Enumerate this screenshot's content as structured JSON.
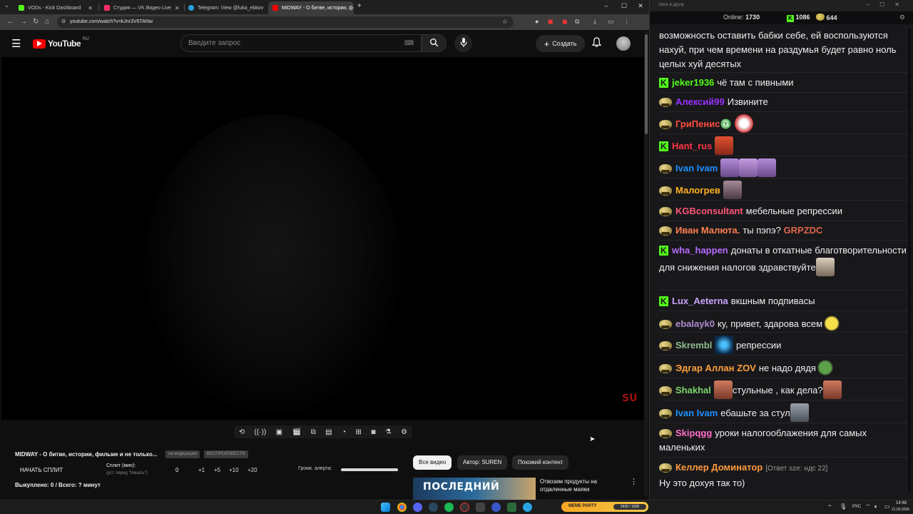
{
  "browser": {
    "tabs": [
      {
        "title": "VODs - Kick Dashboard",
        "color": "#53fc18",
        "active": false
      },
      {
        "title": "Студия — VK Видео Live",
        "color": "#ff2e63",
        "active": false
      },
      {
        "title": "Telegram: View @luka_ebkov",
        "color": "#2aa3e0",
        "active": false
      },
      {
        "title": "MIDWAY - О битве, истории, ф",
        "color": "#ff0000",
        "active": true
      }
    ],
    "new_tab_icon": "plus-icon",
    "url": "youtube.com/watch?v=kJnr3V6TANw"
  },
  "youtube": {
    "logo_text": "YouTube",
    "region": "RU",
    "search_placeholder": "Введите запрос",
    "create_label": "Создать",
    "watermark": "SU",
    "video_title": "MIDWAY - О битве, истории, фильме и не только...",
    "tag1": "на модерацию",
    "tag2": "ВОСПРОИЗВЕСТИ",
    "start_split": "НАЧАТЬ СПЛИТ",
    "split_label": "Сплит (мин):",
    "split_hint": "(уст. перед \"Начать\")",
    "split_value": "0",
    "steps": [
      "+1",
      "+5",
      "+10",
      "+20"
    ],
    "alert_volume_label": "Громк. алерта:",
    "alert_volume_level": 1.0,
    "bought_summary": "Выкуплено: 0 / Всего: ? минут",
    "chips": [
      "Все видео",
      "Автор: SUREN",
      "Похожий контент"
    ],
    "recommendation": {
      "thumbnail_text": "ПОСЛЕДНИЙ",
      "title": "Отвозим продукты на отдаленные маяки"
    }
  },
  "chat": {
    "window_title": "Окно в друзу",
    "online_label": "Online:",
    "online_count": "1730",
    "kick_count": "1086",
    "other_count": "644",
    "messages": [
      {
        "badge": "none",
        "user": "",
        "color": "#efeff1",
        "text": "возможность оставить бабки себе, ей воспользуются нахуй, при чем времени на раздумья будет равно ноль целых хуй десятых",
        "emotes": 0
      },
      {
        "badge": "kick",
        "user": "jeker1936",
        "color": "#53fc18",
        "text": "чё там с пивными",
        "emotes": 0
      },
      {
        "badge": "face",
        "user": "Алексий99",
        "color": "#9b30ff",
        "text": "Извините",
        "emotes": 0
      },
      {
        "badge": "face",
        "user": "ГриПенис♎",
        "color": "#ff4d3d",
        "text": "",
        "emotes": 1
      },
      {
        "badge": "kick",
        "user": "Hant_rus",
        "color": "#ff3344",
        "text": "",
        "emotes": 1
      },
      {
        "badge": "face",
        "user": "Ivan Ivam",
        "color": "#1e90ff",
        "text": "",
        "emotes": 3
      },
      {
        "badge": "face",
        "user": "Малогрев",
        "color": "#ffb020",
        "text": "",
        "emotes": 1
      },
      {
        "badge": "face",
        "user": "KGBconsultant",
        "color": "#ff5577",
        "text": "мебельные репрессии",
        "emotes": 0
      },
      {
        "badge": "face",
        "user": "Иван Малюта.",
        "color": "#ff7f50",
        "text": "ты пэпэ?",
        "ref": "GRPZDC",
        "emotes": 0
      },
      {
        "badge": "kick",
        "user": "wha_happen",
        "color": "#b86bff",
        "text": "донаты в откатные благотворительности для снижения налогов здравствуйте",
        "emotes": 1
      },
      {
        "badge": "kick",
        "user": "Lux_Aeterna",
        "color": "#c8a2ff",
        "text": "вкшным подпивасы",
        "emotes": 0
      },
      {
        "badge": "face",
        "user": "ebalayk0",
        "color": "#b08ad0",
        "text": "ку, привет, здарова всем",
        "emotes": 1
      },
      {
        "badge": "face",
        "user": "Skrembl",
        "color": "#8fbc8f",
        "text": "репрессии",
        "emotes": 1
      },
      {
        "badge": "face",
        "user": "Эдгар Аллан ZOV",
        "color": "#ffa040",
        "text": "не надо дядя",
        "emotes": 1
      },
      {
        "badge": "face",
        "user": "Shakhal",
        "color": "#7cd66a",
        "text": "стульные , как дела?",
        "emotes": 2
      },
      {
        "badge": "face",
        "user": "Ivan Ivam",
        "color": "#1e90ff",
        "text": "ебашьте за стул",
        "emotes": 1
      },
      {
        "badge": "face",
        "user": "Skipqgg",
        "color": "#ff6ec7",
        "text": "уроки налогооблажения для самых маленьких",
        "emotes": 0
      },
      {
        "badge": "face",
        "user": "Келлер Доминатор",
        "color": "#ff9a3d",
        "reply": "[Ответ sze: ндс 22]",
        "text": "Ну это дохуя так то)",
        "emotes": 0
      }
    ]
  },
  "taskbar": {
    "meme_party": "MEME PARTY",
    "meme_progress": "2930 / 1500",
    "lang": "РУС",
    "time": "14:48",
    "date": "21.02.2026"
  },
  "icons": [
    "search-icon",
    "mic-icon",
    "bell-icon",
    "menu-icon",
    "plus-icon",
    "gear-icon",
    "kick-icon",
    "windows-start-icon"
  ]
}
